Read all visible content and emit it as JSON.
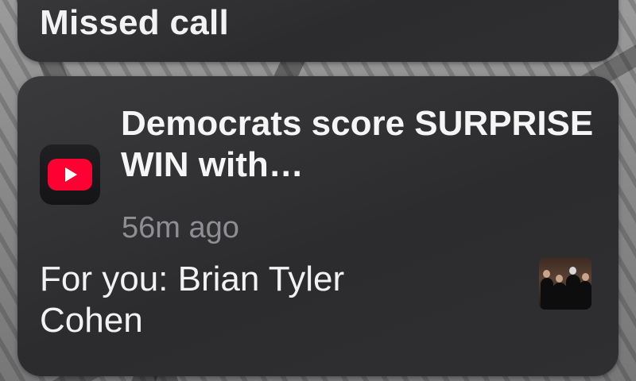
{
  "previous_notification": {
    "title": "Missed call"
  },
  "notification": {
    "app_icon": "youtube-icon",
    "headline": "Democrats score SURPRISE WIN with…",
    "timestamp": "56m ago",
    "body": "For you: Brian Tyler Cohen",
    "thumbnail": "video-thumbnail"
  },
  "colors": {
    "card": "#2c2c2e",
    "text": "#f2f2f2",
    "secondary_text": "#8e8e93",
    "youtube_red": "#ff0033"
  }
}
